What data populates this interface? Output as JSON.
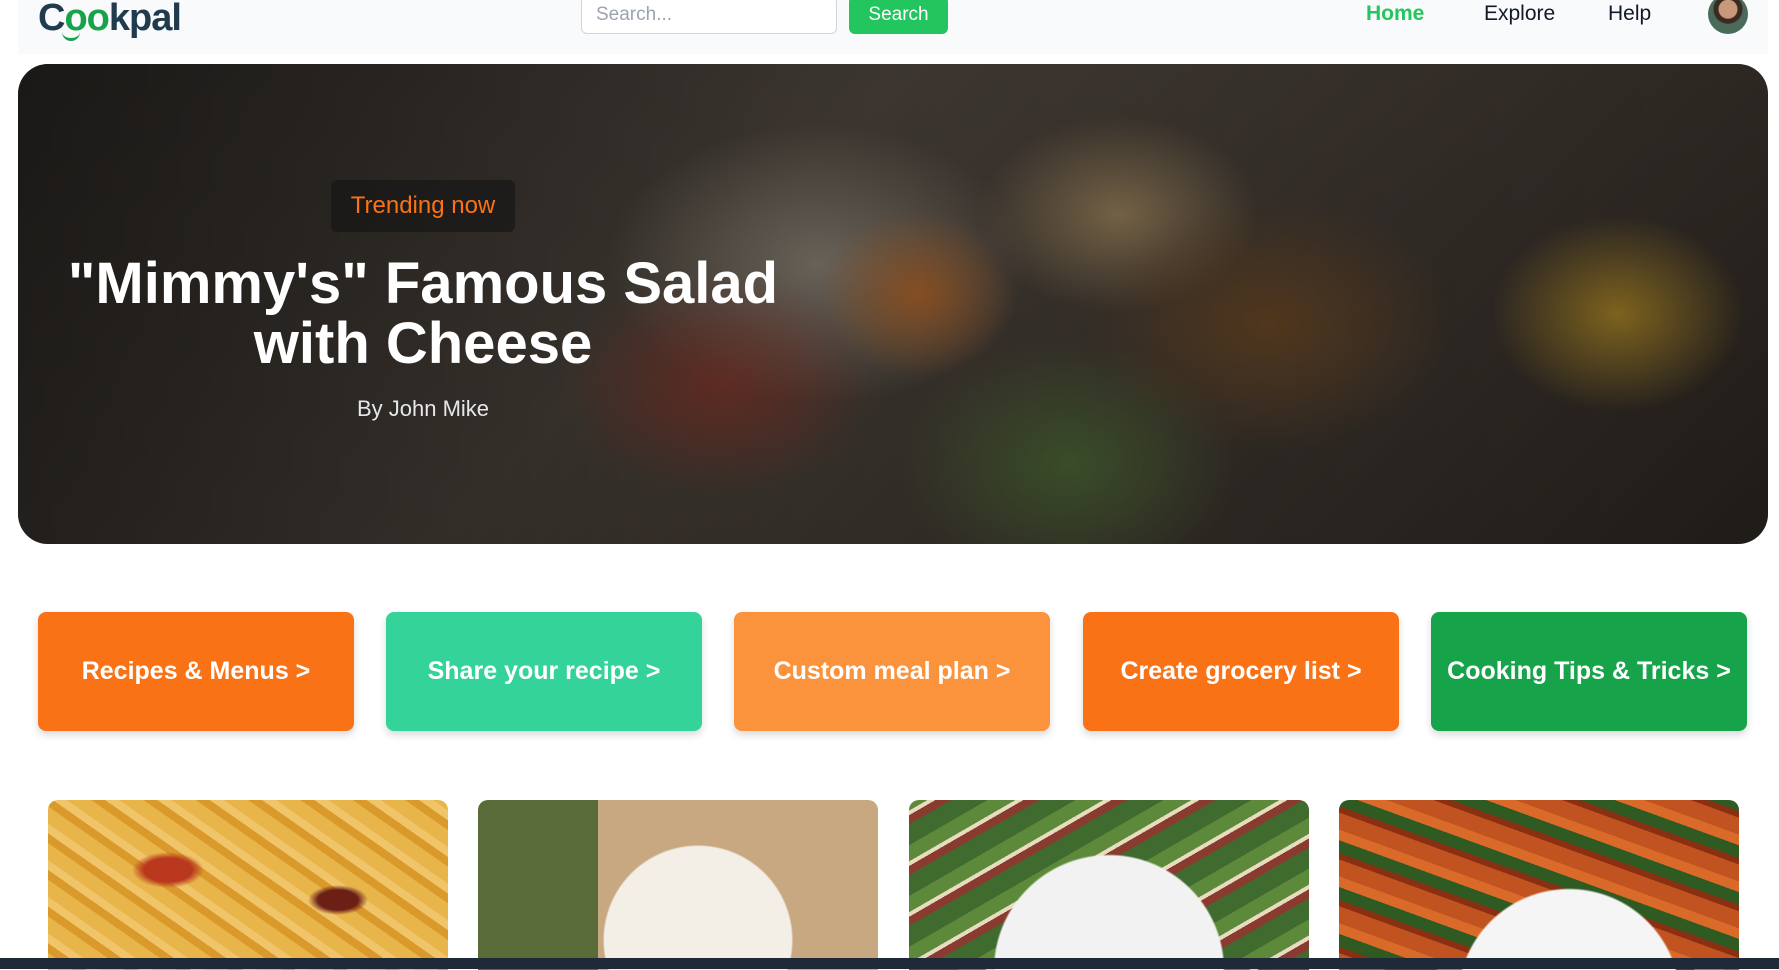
{
  "header": {
    "logo_text_1": "C",
    "logo_text_2": "oo",
    "logo_text_3": "kpal",
    "search_placeholder": "Search...",
    "search_button": "Search",
    "nav": [
      {
        "label": "Home",
        "active": true
      },
      {
        "label": "Explore",
        "active": false
      },
      {
        "label": "Help",
        "active": false
      }
    ]
  },
  "hero": {
    "badge": "Trending now",
    "title_line1": "\"Mimmy's\" Famous Salad",
    "title_line2": "with Cheese",
    "author": "By John Mike"
  },
  "categories": [
    {
      "label": "Recipes & Menus >",
      "color": "#f97316"
    },
    {
      "label": "Share your recipe >",
      "color": "#34d399"
    },
    {
      "label": "Custom meal plan >",
      "color": "#fb923c"
    },
    {
      "label": "Create grocery list >",
      "color": "#f97316"
    },
    {
      "label": "Cooking Tips & Tricks >",
      "color": "#16a34a"
    }
  ],
  "colors": {
    "accent_green": "#22c55e",
    "accent_orange": "#f97316"
  }
}
